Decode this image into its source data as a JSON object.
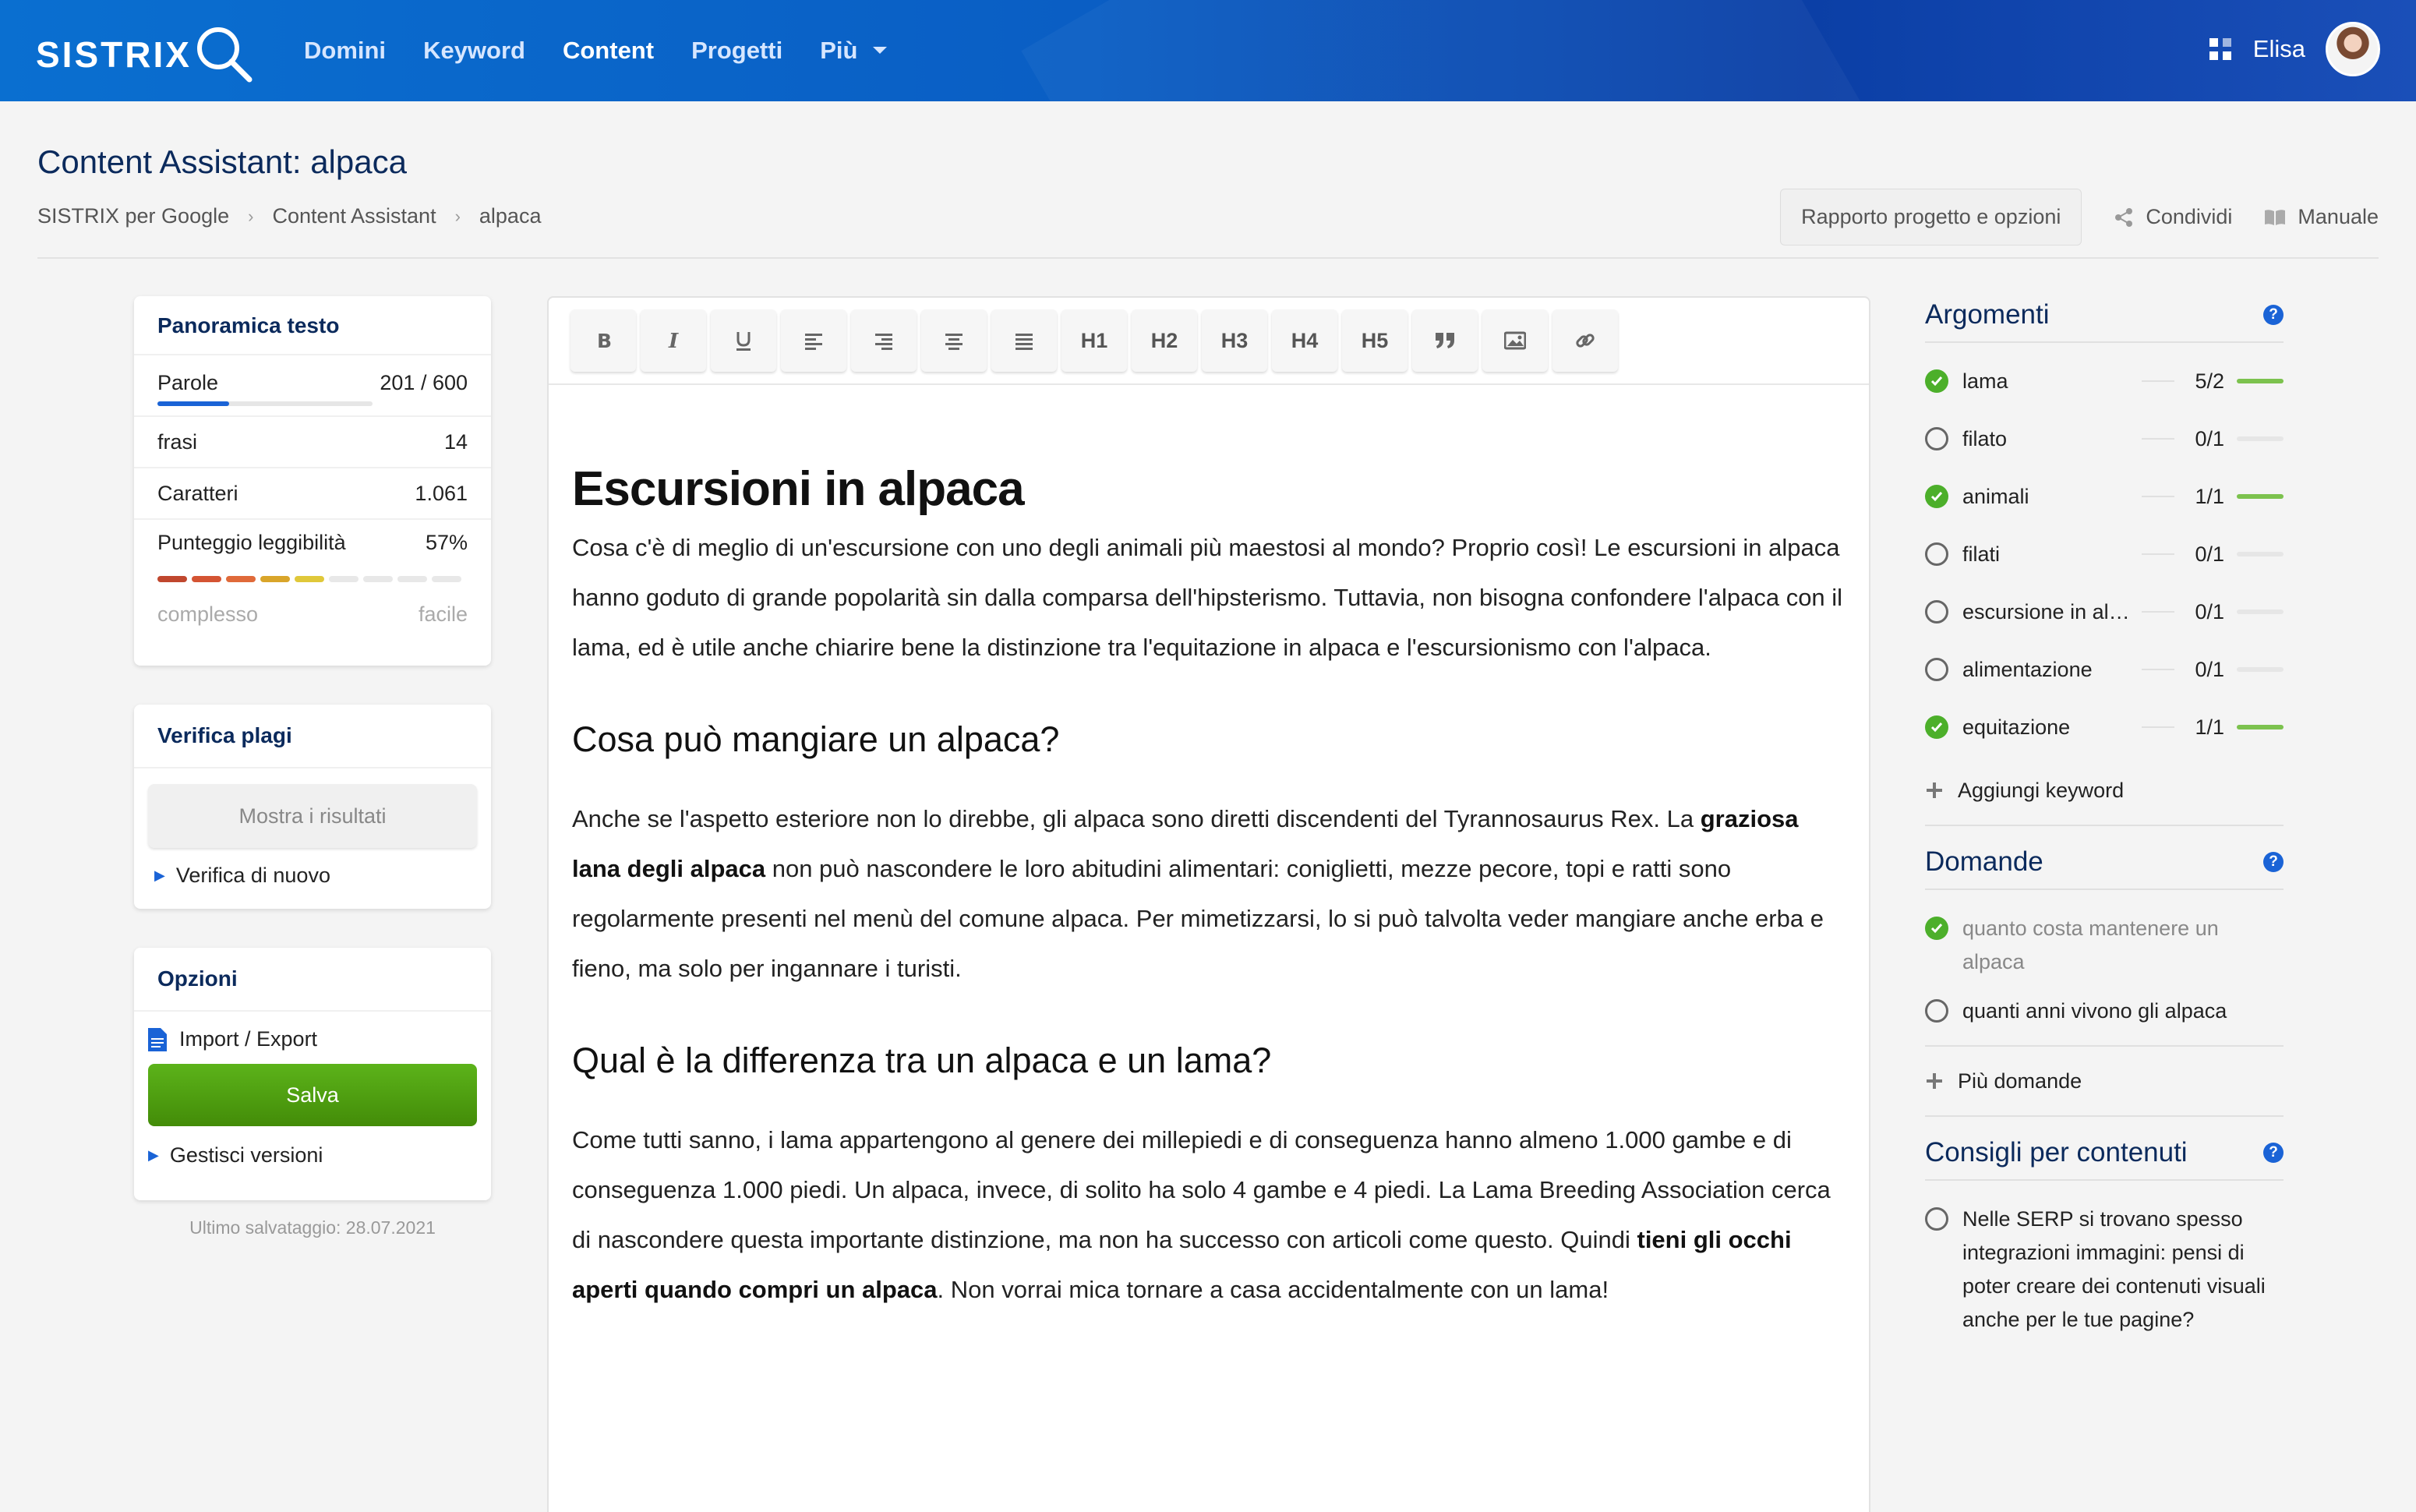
{
  "brand": {
    "name": "SISTRIX"
  },
  "nav": {
    "items": [
      "Domini",
      "Keyword",
      "Content",
      "Progetti",
      "Più"
    ],
    "active_index": 2
  },
  "user": {
    "name": "Elisa"
  },
  "page": {
    "title": "Content Assistant: alpaca"
  },
  "breadcrumb": [
    "SISTRIX per Google",
    "Content Assistant",
    "alpaca"
  ],
  "header_actions": {
    "report": "Rapporto progetto e opzioni",
    "share": "Condividi",
    "manual": "Manuale"
  },
  "overview": {
    "title": "Panoramica testo",
    "words_label": "Parole",
    "words_value": "201 / 600",
    "words_progress": 0.335,
    "sentences_label": "frasi",
    "sentences_value": "14",
    "chars_label": "Caratteri",
    "chars_value": "1.061",
    "readability_label": "Punteggio leggibilità",
    "readability_value": "57%",
    "readability_segments": [
      "#c0472e",
      "#d45433",
      "#e06a3a",
      "#d9a52a",
      "#e0c83a",
      "#e8e8e8",
      "#e8e8e8",
      "#e8e8e8",
      "#e8e8e8"
    ],
    "scale_low": "complesso",
    "scale_high": "facile"
  },
  "plagiarism": {
    "title": "Verifica plagi",
    "show_button": "Mostra i risultati",
    "recheck": "Verifica di nuovo"
  },
  "options": {
    "title": "Opzioni",
    "import_export": "Import / Export",
    "save": "Salva",
    "versions": "Gestisci versioni",
    "last_saved": "Ultimo salvataggio: 28.07.2021"
  },
  "toolbar": {
    "headings": [
      "H1",
      "H2",
      "H3",
      "H4",
      "H5"
    ]
  },
  "article": {
    "h1": "Escursioni in alpaca",
    "p1": "Cosa c'è di meglio di un'escursione con uno degli animali più maestosi al mondo? Proprio così! Le escursioni in alpaca hanno goduto di grande popolarità sin dalla comparsa dell'hipsterismo. Tuttavia, non bisogna confondere l'alpaca con il lama, ed è utile anche chiarire bene la distinzione tra l'equitazione in alpaca e l'escursionismo con l'alpaca.",
    "h2a": "Cosa può mangiare un alpaca?",
    "p2_a": "Anche se l'aspetto esteriore non lo direbbe, gli alpaca sono diretti discendenti del Tyrannosaurus Rex. La ",
    "p2_b": "graziosa lana degli alpaca",
    "p2_c": " non può nascondere le loro abitudini alimentari: coniglietti, mezze pecore, topi e ratti sono regolarmente presenti nel menù del comune alpaca. Per mimetizzarsi, lo si può talvolta veder mangiare anche erba e fieno, ma solo per ingannare i turisti.",
    "h2b": "Qual è la differenza tra un alpaca e un lama?",
    "p3_a": "Come tutti sanno, i lama appartengono al genere dei millepiedi e di conseguenza hanno almeno 1.000 gambe e di conseguenza 1.000 piedi. Un alpaca, invece, di solito ha solo 4 gambe e 4 piedi. La Lama Breeding Association cerca di nascondere questa importante distinzione, ma non ha successo con articoli come questo. Quindi ",
    "p3_b": "tieni gli occhi aperti quando compri un alpaca",
    "p3_c": ". Non vorrai mica tornare a casa accidentalmente con un lama!"
  },
  "topics": {
    "title": "Argomenti",
    "items": [
      {
        "name": "lama",
        "count": "5/2",
        "checked": true
      },
      {
        "name": "filato",
        "count": "0/1",
        "checked": false
      },
      {
        "name": "animali",
        "count": "1/1",
        "checked": true
      },
      {
        "name": "filati",
        "count": "0/1",
        "checked": false
      },
      {
        "name": "escursione in alp...",
        "count": "0/1",
        "checked": false
      },
      {
        "name": "alimentazione",
        "count": "0/1",
        "checked": false
      },
      {
        "name": "equitazione",
        "count": "1/1",
        "checked": true
      }
    ],
    "add": "Aggiungi keyword"
  },
  "questions": {
    "title": "Domande",
    "items": [
      {
        "text": "quanto costa mantenere un alpaca",
        "checked": true
      },
      {
        "text": "quanti anni vivono gli alpaca",
        "checked": false
      }
    ],
    "more": "Più domande"
  },
  "tips": {
    "title": "Consigli per contenuti",
    "items": [
      {
        "text": "Nelle SERP si trovano spesso integrazioni immagini: pensi di poter creare dei contenuti visuali anche per le tue pagine?",
        "checked": false
      }
    ]
  },
  "colors": {
    "brand_blue": "#0a6fd0",
    "navy": "#0b2a5c",
    "green": "#4caf2a",
    "save_green": "#4a9a0a"
  }
}
